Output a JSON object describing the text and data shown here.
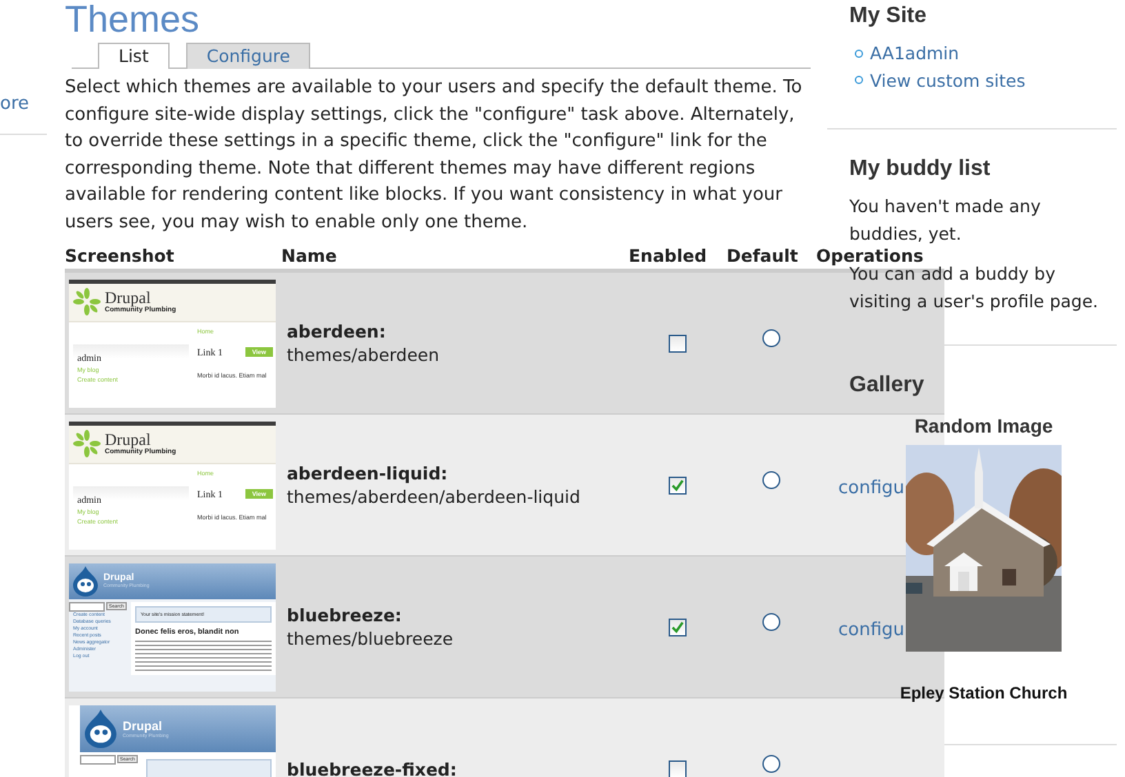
{
  "left_sidebar": {
    "link": "ore"
  },
  "page": {
    "title": "Themes",
    "tabs": [
      {
        "label": "List",
        "selected": true
      },
      {
        "label": "Configure",
        "selected": false
      }
    ],
    "description": "Select which themes are available to your users and specify the default theme. To configure site-wide display settings, click the \"configure\" task above. Alternately, to override these settings in a specific theme, click the \"configure\" link for the corresponding theme. Note that different themes may have different regions available for rendering content like blocks. If you want consistency in what your users see, you may wish to enable only one theme.",
    "table": {
      "columns": [
        "Screenshot",
        "Name",
        "Enabled",
        "Default",
        "Operations"
      ],
      "rows": [
        {
          "thumbnail": {
            "kind": "aberdeen",
            "title": "Drupal",
            "slogan": "Community Plumbing",
            "breadcrumb": "Home",
            "user": "admin",
            "menu": [
              "My blog",
              "Create content"
            ],
            "heading": "Link 1",
            "button": "View",
            "body": "Morbi id lacus. Etiam mal"
          },
          "name": "aberdeen:",
          "path": "themes/aberdeen",
          "enabled": false,
          "default": {
            "selected": false
          }
        },
        {
          "thumbnail": {
            "kind": "aberdeen",
            "title": "Drupal",
            "slogan": "Community Plumbing",
            "breadcrumb": "Home",
            "user": "admin",
            "menu": [
              "My blog",
              "Create content"
            ],
            "heading": "Link 1",
            "button": "View",
            "body": "Morbi id lacus. Etiam mal"
          },
          "name": "aberdeen-liquid:",
          "path": "themes/aberdeen/aberdeen-liquid",
          "enabled": true,
          "default": {
            "selected": false
          },
          "operation": "configu"
        },
        {
          "thumbnail": {
            "kind": "bluebreeze",
            "title": "Drupal",
            "slogan": "Community Plumbing",
            "search_button": "Search",
            "mission": "Your site's mission statement!",
            "heading": "Donec felis eros, blandit non",
            "menu": [
              "Create content",
              "Database queries",
              "My account",
              "Recent posts",
              "News aggregator",
              "Administer",
              "Log out"
            ]
          },
          "name": "bluebreeze:",
          "path": "themes/bluebreeze",
          "enabled": true,
          "default": {
            "selected": false
          },
          "operation": "configu"
        },
        {
          "thumbnail": {
            "kind": "bluebreeze-fixed",
            "title": "Drupal",
            "slogan": "Community Plumbing",
            "search_button": "Search"
          },
          "name": "bluebreeze-fixed:",
          "enabled": false,
          "default": {
            "selected": false
          }
        }
      ]
    }
  },
  "right_sidebar": {
    "my_site": {
      "title": "My Site",
      "links": [
        "AA1admin",
        "View custom sites"
      ]
    },
    "buddy_list": {
      "title": "My buddy list",
      "paragraphs": [
        "You haven't made any buddies, yet.",
        "You can add a buddy by visiting a user's profile page."
      ]
    },
    "gallery": {
      "title": "Gallery",
      "subtitle": "Random Image",
      "caption": "Epley Station Church"
    }
  }
}
